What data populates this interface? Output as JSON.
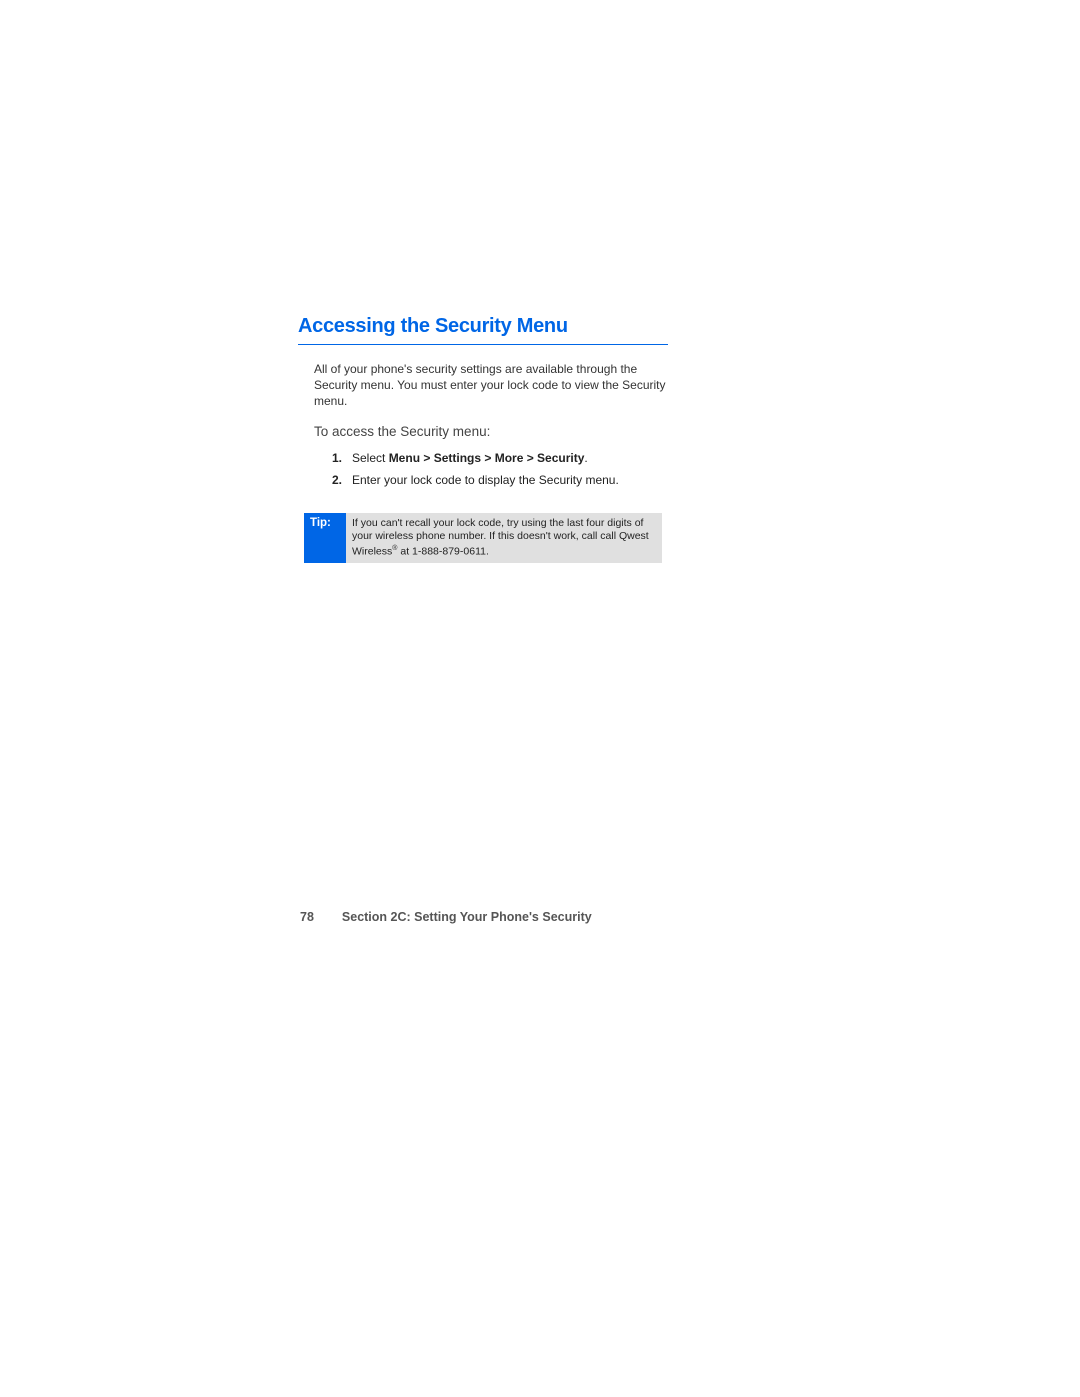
{
  "heading": "Accessing the Security Menu",
  "intro": "All of your phone's security settings are available through the Security menu. You must enter your lock code to view the Security menu.",
  "subheading": "To access the Security menu:",
  "steps": [
    {
      "num": "1.",
      "prefix": "Select ",
      "bold": "Menu > Settings > More > Security",
      "suffix": "."
    },
    {
      "num": "2.",
      "prefix": "Enter your lock code to display the Security menu.",
      "bold": "",
      "suffix": ""
    }
  ],
  "tip": {
    "label": "Tip:",
    "text_before": "If you can't recall your lock code, try using the last four digits of your wireless phone number. If this doesn't work, call call Qwest Wireless",
    "reg": "®",
    "text_after": " at 1-888-879-0611."
  },
  "footer": {
    "page_num": "78",
    "section": "Section 2C: Setting Your Phone's Security"
  }
}
